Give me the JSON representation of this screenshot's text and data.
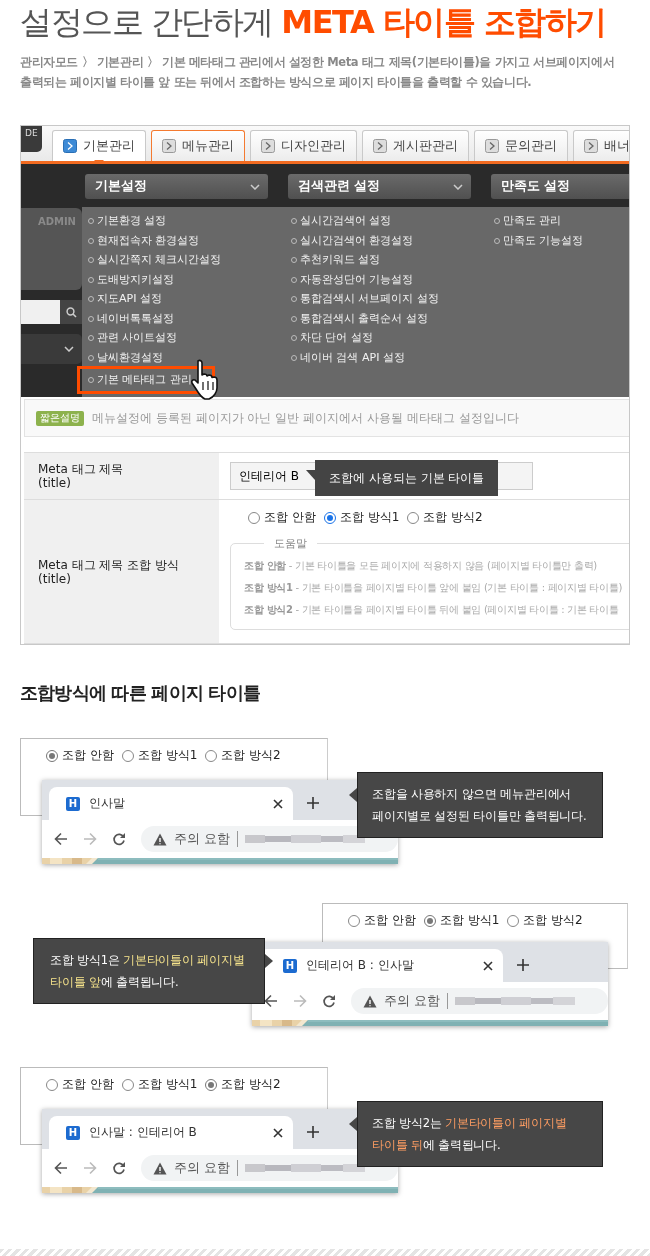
{
  "heading": {
    "parts": [
      {
        "text": "설정으로 간단하게",
        "accent": false
      },
      {
        "text": "META 타이틀 조합하기",
        "accent": true
      }
    ]
  },
  "intro": "관리자모드 〉 기본관리 〉 기본 메타태그 관리에서 설정한 Meta 태그 제목(기본타이틀)을 가지고 서브페이지에서 출력되는 페이지별 타이틀 앞 또는 뒤에서 조합하는 방식으로 페이지 타이틀을 출력할 수 있습니다.",
  "admin": {
    "logo_text": "DE",
    "tabs": [
      {
        "label": "기본관리",
        "selected": true,
        "hovered": false
      },
      {
        "label": "메뉴관리",
        "selected": false,
        "hovered": true
      },
      {
        "label": "디자인관리",
        "selected": false,
        "hovered": false
      },
      {
        "label": "게시판관리",
        "selected": false,
        "hovered": false
      },
      {
        "label": "문의관리",
        "selected": false,
        "hovered": false
      },
      {
        "label": "배너",
        "selected": false,
        "hovered": false
      }
    ],
    "sidebar_label": "ADMIN",
    "menu": [
      {
        "title": "기본설정",
        "items": [
          {
            "label": "기본환경 설정",
            "selected": false
          },
          {
            "label": "현재접속자 환경설정",
            "selected": false
          },
          {
            "label": "실시간쪽지 체크시간설정",
            "selected": false
          },
          {
            "label": "도배방지키설정",
            "selected": false
          },
          {
            "label": "지도API 설정",
            "selected": false
          },
          {
            "label": "네이버톡톡설정",
            "selected": false
          },
          {
            "label": "관련 사이트설정",
            "selected": false
          },
          {
            "label": "날씨환경설정",
            "selected": false
          },
          {
            "label": "기본 메타태그 관리",
            "selected": true
          }
        ]
      },
      {
        "title": "검색관련 설정",
        "items": [
          {
            "label": "실시간검색어 설정",
            "selected": false
          },
          {
            "label": "실시간검색어 환경설정",
            "selected": false
          },
          {
            "label": "추천키워드 설정",
            "selected": false
          },
          {
            "label": "자동완성단어 기능설정",
            "selected": false
          },
          {
            "label": "통합검색시 서브페이지 설정",
            "selected": false
          },
          {
            "label": "통합검색시 출력순서 설정",
            "selected": false
          },
          {
            "label": "차단 단어 설정",
            "selected": false
          },
          {
            "label": "네이버 검색 API 설정",
            "selected": false
          }
        ]
      },
      {
        "title": "만족도 설정",
        "items": [
          {
            "label": "만족도 관리",
            "selected": false
          },
          {
            "label": "만족도 기능설정",
            "selected": false
          }
        ]
      }
    ],
    "short_desc": {
      "badge": "짧은설명",
      "text": "메뉴설정에 등록된 페이지가 아닌 일반 페이지에서 사용될 메타태그 설정입니다"
    },
    "form": {
      "title_label": [
        "Meta 태그 제목",
        "(title)"
      ],
      "title_value": "인테리어 B",
      "title_tooltip": "조합에 사용되는 기본 타이틀",
      "mode_label": [
        "Meta 태그 제목 조합 방식",
        "(title)"
      ],
      "radios": [
        {
          "label": "조합 안함",
          "selected": false
        },
        {
          "label": "조합 방식1",
          "selected": true
        },
        {
          "label": "조합 방식2",
          "selected": false
        }
      ],
      "help_title": "도움말",
      "help_lines": [
        "**조합 안함** - 기본 타이틀을 모든 페이지에 적용하지 않음 (페이지별 타이틀만 출력)",
        "**조합 방식1** - 기본 타이틀을 페이지별 타이틀 앞에 붙임 (기본 타이틀 : 페이지별 타이틀)",
        "**조합 방식2** - 기본 타이틀을 페이지별 타이틀 뒤에 붙임 (페이지별 타이틀 : 기본 타이틀"
      ]
    }
  },
  "section_title": "조합방식에 따른 페이지 타이틀",
  "examples": [
    {
      "kind": "right",
      "radios": [
        {
          "label": "조합 안함",
          "selected": true
        },
        {
          "label": "조합 방식1",
          "selected": false
        },
        {
          "label": "조합 방식2",
          "selected": false
        }
      ],
      "browser": {
        "favicon": "H",
        "tab_title": "인사말",
        "warning": "주의 요함"
      },
      "tooltip": {
        "parts": [
          {
            "text": "조합을 사용하지 않으면 메뉴관리에서 페이지별로 설정된 타이틀만 출력됩니다."
          }
        ]
      }
    },
    {
      "kind": "left",
      "radios": [
        {
          "label": "조합 안함",
          "selected": false
        },
        {
          "label": "조합 방식1",
          "selected": true
        },
        {
          "label": "조합 방식2",
          "selected": false
        }
      ],
      "browser": {
        "favicon": "H",
        "tab_title": "인테리어 B : 인사말",
        "warning": "주의 요함"
      },
      "tooltip": {
        "parts": [
          {
            "text": "조합 방식1은 "
          },
          {
            "text": "기본타이틀이 페이지별 타이틀 앞",
            "color": "#f7e48c"
          },
          {
            "text": "에 출력됩니다."
          }
        ]
      }
    },
    {
      "kind": "right",
      "radios": [
        {
          "label": "조합 안함",
          "selected": false
        },
        {
          "label": "조합 방식1",
          "selected": false
        },
        {
          "label": "조합 방식2",
          "selected": true
        }
      ],
      "browser": {
        "favicon": "H",
        "tab_title": "인사말 : 인테리어 B",
        "warning": "주의 요함"
      },
      "tooltip": {
        "parts": [
          {
            "text": "조합 방식2는 "
          },
          {
            "text": "기본타이틀이 페이지별 타이틀 뒤",
            "color": "#ff9d62"
          },
          {
            "text": "에 출력됩니다."
          }
        ]
      }
    }
  ]
}
